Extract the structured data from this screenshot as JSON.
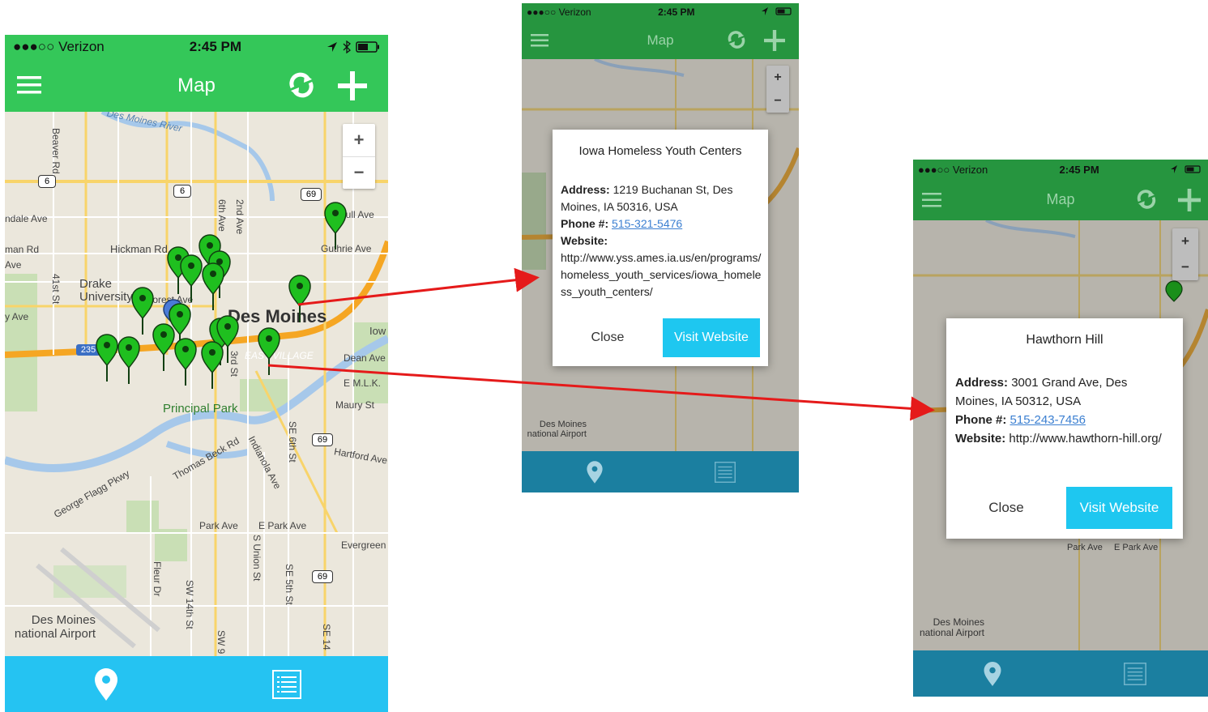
{
  "status": {
    "carrier": "●●●○○ Verizon",
    "time": "2:45 PM"
  },
  "nav": {
    "title": "Map",
    "menu_icon": "hamburger-menu-icon",
    "refresh_icon": "refresh-icon",
    "add_icon": "plus-icon"
  },
  "zoom": {
    "in": "+",
    "out": "−"
  },
  "map_labels": {
    "des_moines": "Des Moines",
    "des_moines_river": "Des Moines River",
    "beaver_rd": "Beaver Rd",
    "hickman_rd": "Hickman Rd",
    "drake": "Drake\nUniversity",
    "forest_ave": "Forest Ave",
    "university_ave": "y Ave",
    "guthrie_ave": "Guthrie Ave",
    "hull_ave": "Hull Ave",
    "sixth_ave": "6th Ave",
    "second_ave": "2nd Ave",
    "third_st": "3rd St",
    "east_village": "EAST VILLAGE",
    "dean_ave": "Dean Ave",
    "emlk": "E M.L.K.",
    "maury_st": "Maury St",
    "principal_park": "Principal Park",
    "thomas_beck_rd": "Thomas Beck Rd",
    "indianola_ave": "Indianola Ave",
    "se_6th_st": "SE 6th St",
    "hartford_ave": "Hartford Ave",
    "george_flagg": "George Flagg Pkwy",
    "park_ave": "Park Ave",
    "e_park_ave": "E Park Ave",
    "evergreen": "Evergreen",
    "s_union_st": "S Union St",
    "se_5th_st": "SE 5th St",
    "fleur_dr": "Fleur Dr",
    "sw_14th_st": "SW 14th St",
    "sw_9": "SW 9",
    "se_14": "SE 14",
    "airport": "Des Moines\nnational Airport",
    "forty_first": "41st St",
    "ndale": "ndale Ave",
    "man_rd": "man Rd",
    "ave": "Ave",
    "iow": "Iow",
    "shield_6": "6",
    "shield_69": "69",
    "shield_235": "235"
  },
  "tabs": {
    "map_icon": "map-pin-icon",
    "list_icon": "list-icon"
  },
  "dialog1": {
    "title": "Iowa Homeless Youth Centers",
    "address_label": "Address:",
    "address": " 1219 Buchanan St, Des Moines, IA 50316, USA",
    "phone_label": "Phone #:",
    "phone": "515-321-5476",
    "website_label": "Website:",
    "website": "http://www.yss.ames.ia.us/en/programs/homeless_youth_services/iowa_homeless_youth_centers/",
    "close": "Close",
    "visit": "Visit Website"
  },
  "dialog2": {
    "title": "Hawthorn Hill",
    "address_label": "Address:",
    "address": " 3001 Grand Ave, Des Moines, IA 50312, USA",
    "phone_label": "Phone #:",
    "phone": "515-243-7456",
    "website_label": "Website:",
    "website": " http://www.hawthorn-hill.org/",
    "close": "Close",
    "visit": "Visit Website"
  },
  "colors": {
    "nav_green": "#34c759",
    "nav_green_dim": "#26953f",
    "tab_blue": "#25c3f2",
    "tab_blue_dim": "#1b7fa0",
    "pin_green": "#1fbf1f",
    "arrow_red": "#e51a1a"
  }
}
